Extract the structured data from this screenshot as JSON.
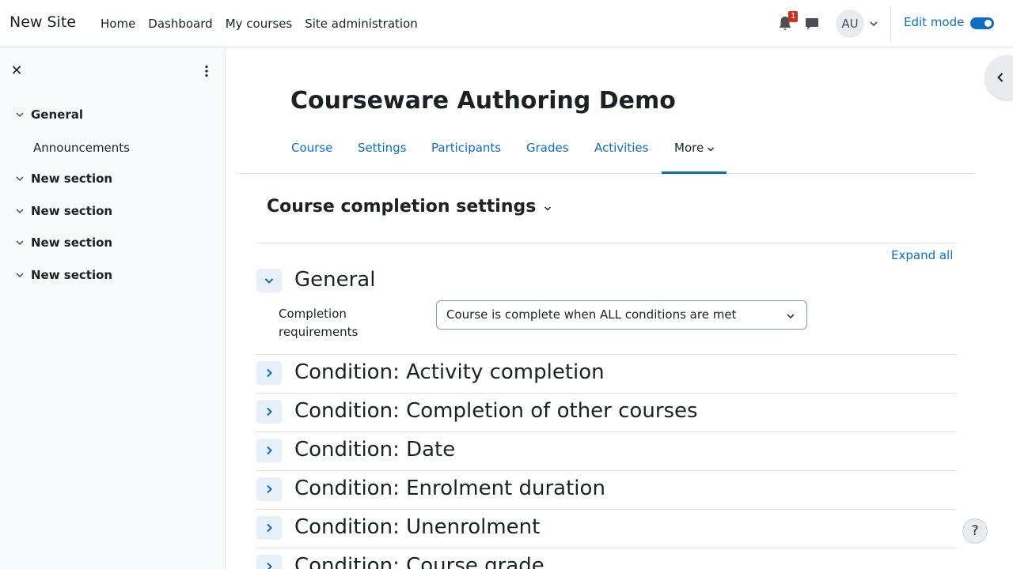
{
  "navbar": {
    "brand": "New Site",
    "links": [
      "Home",
      "Dashboard",
      "My courses",
      "Site administration"
    ],
    "notification_count": "1",
    "user_initials": "AU",
    "edit_mode_label": "Edit mode"
  },
  "course_index": {
    "items": [
      "General",
      "New section",
      "New section",
      "New section",
      "New section"
    ],
    "sub_item": "Announcements"
  },
  "course": {
    "title": "Courseware Authoring Demo",
    "tabs": [
      "Course",
      "Settings",
      "Participants",
      "Grades",
      "Activities"
    ],
    "more_label": "More"
  },
  "page": {
    "heading": "Course completion settings",
    "expand_all": "Expand all",
    "general_title": "General",
    "completion_label": "Completion requirements",
    "completion_value": "Course is complete when ALL conditions are met",
    "conditions": [
      "Condition: Activity completion",
      "Condition: Completion of other courses",
      "Condition: Date",
      "Condition: Enrolment duration",
      "Condition: Unenrolment",
      "Condition: Course grade"
    ]
  },
  "help": {
    "label": "?"
  },
  "colors": {
    "link": "#0f6cbf",
    "text": "#1d2125",
    "drawer_bg": "#f8f9fa",
    "badge": "#ca3120"
  }
}
